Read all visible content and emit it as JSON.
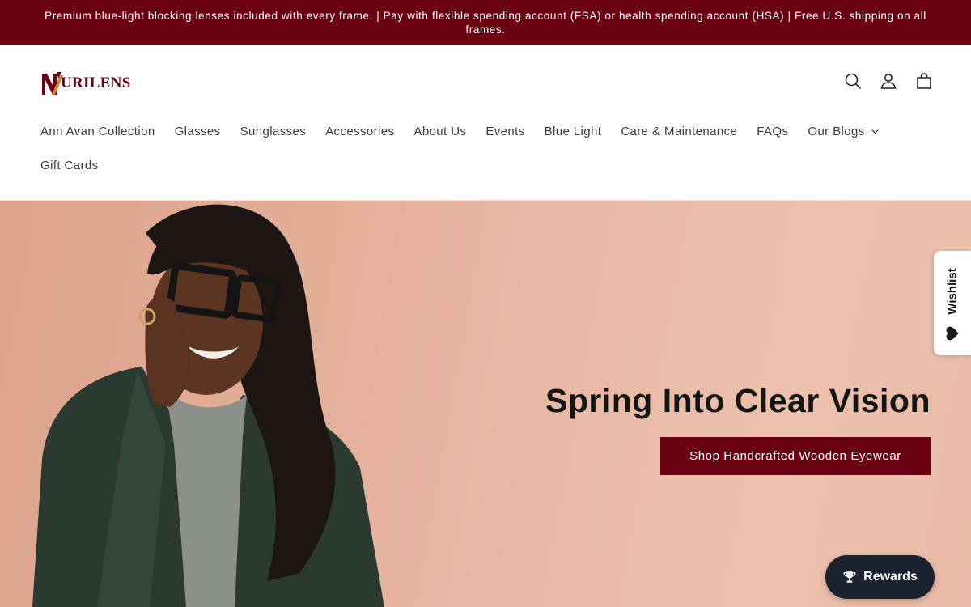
{
  "announcement": {
    "text": "Premium blue-light blocking lenses included with every frame. | Pay with flexible spending account (FSA) or health spending account (HSA) | Free U.S. shipping on all frames."
  },
  "brand": {
    "name": "URILENS",
    "color": "#6b0212"
  },
  "header_icons": [
    "search-icon",
    "account-icon",
    "cart-icon"
  ],
  "nav": {
    "items": [
      {
        "label": "Ann Avan Collection"
      },
      {
        "label": "Glasses"
      },
      {
        "label": "Sunglasses"
      },
      {
        "label": "Accessories"
      },
      {
        "label": "About Us"
      },
      {
        "label": "Events"
      },
      {
        "label": "Blue Light"
      },
      {
        "label": "Care & Maintenance"
      },
      {
        "label": "FAQs"
      },
      {
        "label": "Our Blogs"
      },
      {
        "label": "Gift Cards"
      }
    ]
  },
  "hero": {
    "title": "Spring Into Clear Vision",
    "cta_label": "Shop Handcrafted Wooden Eyewear"
  },
  "wishlist": {
    "label": "Wishlist"
  },
  "rewards": {
    "label": "Rewards"
  },
  "colors": {
    "accent": "#6b0212",
    "rewards_bg": "#1a2230",
    "hero_bg": "#e6b49f"
  }
}
